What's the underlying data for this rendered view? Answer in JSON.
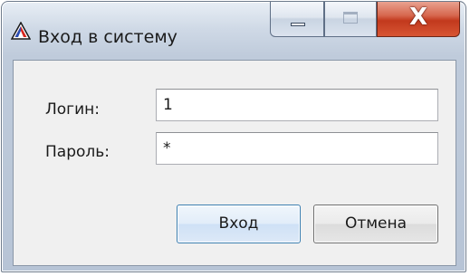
{
  "window": {
    "title": "Вход в систему"
  },
  "caption": {
    "minimize_icon": "minimize-icon",
    "maximize_icon": "maximize-icon",
    "close_icon": "close-icon",
    "close_glyph": "X"
  },
  "form": {
    "login_label": "Логин:",
    "login_value": "1",
    "password_label": "Пароль:",
    "password_value": "*"
  },
  "buttons": {
    "login_label": "Вход",
    "cancel_label": "Отмена"
  },
  "colors": {
    "close_button": "#c2391d",
    "default_button_border": "#3c7fb1"
  }
}
